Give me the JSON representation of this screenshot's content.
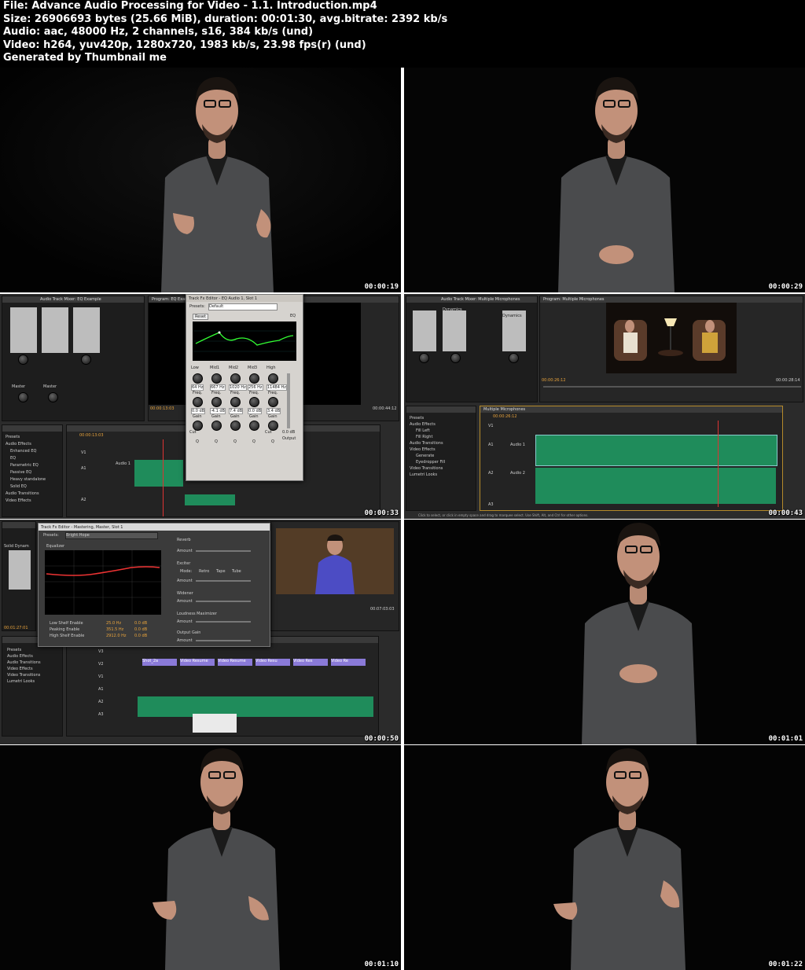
{
  "header": {
    "line1": "File: Advance Audio Processing for Video - 1.1. Introduction.mp4",
    "line2": "Size: 26906693 bytes (25.66 MiB), duration: 00:01:30, avg.bitrate: 2392 kb/s",
    "line3": "Audio: aac, 48000 Hz, 2 channels, s16, 384 kb/s (und)",
    "line4": "Video: h264, yuv420p, 1280x720, 1983 kb/s, 23.98 fps(r) (und)",
    "line5": "Generated by Thumbnail me"
  },
  "thumbnails": [
    {
      "timestamp": "00:00:19"
    },
    {
      "timestamp": "00:00:29"
    },
    {
      "timestamp": "00:00:33"
    },
    {
      "timestamp": "00:00:43"
    },
    {
      "timestamp": "00:00:50"
    },
    {
      "timestamp": "00:01:01"
    },
    {
      "timestamp": "00:01:10"
    },
    {
      "timestamp": "00:01:22"
    }
  ],
  "eq_ui": {
    "dialog_title": "Track Fx Editor - EQ Audio 1, Slot 1",
    "presets_label": "Presets:",
    "preset_value": "Default",
    "eq_label": "EQ",
    "reset_label": "Reset",
    "program_tab": "Program: EQ Example",
    "timecode_left": "00:00:13:03",
    "timecode_right": "00:00:44:12",
    "timeline_timecode": "00:00:13:03",
    "bands": [
      "Low",
      "Mid1",
      "Mid2",
      "Mid3",
      "High"
    ],
    "freqs": [
      "64 Hz",
      "667 Hz",
      "1020 Hz",
      "256 Hz",
      "11484 Hz"
    ],
    "gains": [
      "0.0 dB",
      "-4.1 dB",
      "7.4 dB",
      "0.0 dB",
      "3.4 dB"
    ],
    "freq_label": "Freq.",
    "gain_label": "Gain",
    "q_label": "Q",
    "output_label": "Output",
    "output_value": "0.0 dB",
    "cut_label": "Cut",
    "effects_items": [
      "Presets",
      "Audio Effects",
      "Enhanced EQ",
      "EQ",
      "Parametric EQ",
      "Passive EQ",
      "Heavy standalone",
      "Solid EQ",
      "Audio Transitions",
      "Video Effects"
    ],
    "track_labels": [
      "V1",
      "A1",
      "A2"
    ],
    "audio_track_name": "Audio 1",
    "mixer_tab": "Audio Track Mixer: EQ Example",
    "master_label": "Master"
  },
  "multimic_ui": {
    "mixer_tab": "Audio Track Mixer: Multiple Microphones",
    "program_tab": "Program: Multiple Microphones",
    "timecode_left": "00:00:26:12",
    "timecode_right": "00:00:28:14",
    "timeline_tab": "Multiple Microphones",
    "timeline_timecode": "00:00:26:12",
    "dynamics_label": "Dynamics",
    "effects_items": [
      "Presets",
      "Audio Effects",
      "Fill Left",
      "Fill Right",
      "Audio Transitions",
      "Video Effects",
      "Generate",
      "Eyedropper Fill",
      "Video Transitions",
      "Lumetri Looks"
    ],
    "status_text": "Click to select, or click in empty space and drag to marquee select. Use Shift, Alt, and Ctrl for other options.",
    "track_labels": [
      "V1",
      "A1",
      "A2",
      "A3"
    ],
    "audio1": "Audio 1",
    "audio2": "Audio 2"
  },
  "mastering_ui": {
    "dialog_title": "Track Fx Editor - Mastering, Master, Slot 1",
    "presets_label": "Presets:",
    "preset_value": "Bright Hope",
    "equalizer_label": "Equalizer",
    "reverb_label": "Reverb",
    "amount_label": "Amount",
    "exciter_label": "Exciter",
    "mode_label": "Mode:",
    "modes": [
      "Retro",
      "Tape",
      "Tube"
    ],
    "widener_label": "Widener",
    "loudness_label": "Loudness Maximizer",
    "output_gain_label": "Output Gain",
    "checkboxes": [
      "Low Shelf Enable",
      "Peaking Enable",
      "High Shelf Enable"
    ],
    "values_hz": [
      "25.0 Hz",
      "351.5 Hz",
      "2912.0 Hz"
    ],
    "values_db": [
      "0.0 dB",
      "0.0 dB",
      "0.0 dB"
    ],
    "timecode_left": "00:01:27:01",
    "timecode_right": "00:07:03:03",
    "effects_items": [
      "Presets",
      "Audio Effects",
      "Audio Transitions",
      "Video Effects",
      "Video Transitions",
      "Lumetri Looks"
    ],
    "solid_dynamics": "Solid Dynam",
    "track_labels": [
      "V3",
      "V2",
      "V1",
      "A1",
      "A2",
      "A3"
    ],
    "clip_labels": [
      "Shot_2a",
      "Video Resume",
      "Video Resume",
      "Video Resu",
      "Video Res",
      "Video Re"
    ]
  }
}
